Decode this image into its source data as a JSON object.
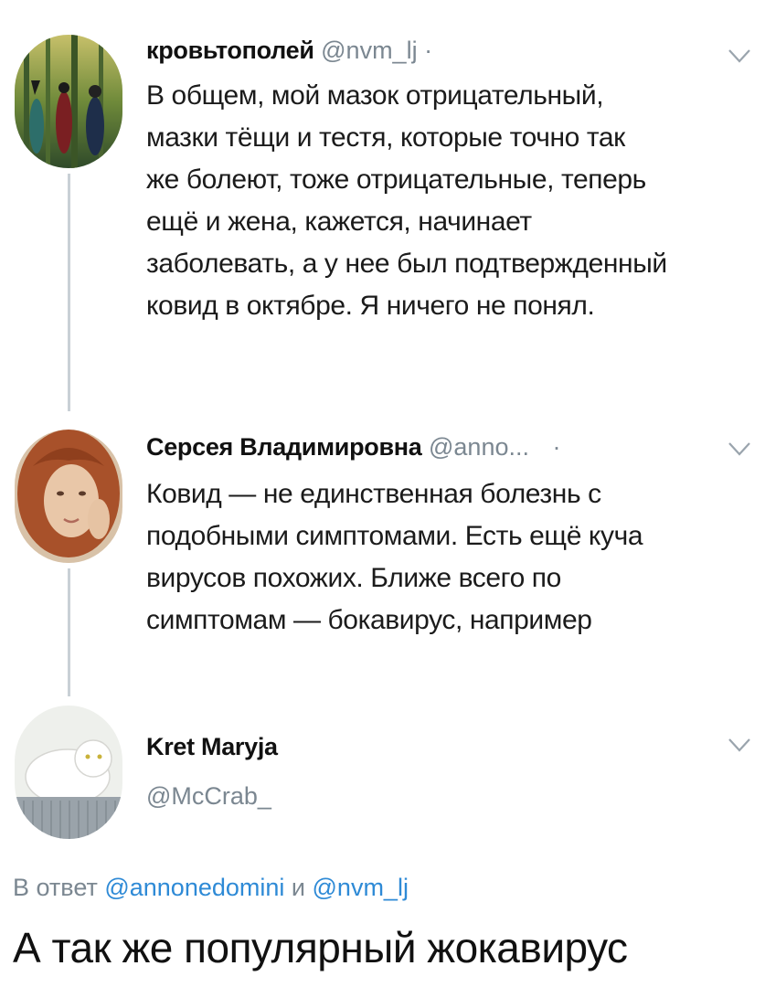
{
  "tweets": [
    {
      "name": "кровьтополей",
      "handle": "@nvm_lj",
      "separator": "·",
      "text_lines": [
        "В общем, мой мазок отрицательный,",
        "мазки тёщи и тестя, которые точно так",
        "же болеют, тоже отрицательные, теперь",
        "ещё и жена, кажется, начинает",
        "заболевать, а у нее был подтвержденный",
        "ковид в октябре. Я ничего не понял."
      ]
    },
    {
      "name": "Серсея Владимировна",
      "handle": "@anno...",
      "separator": "·",
      "text_lines": [
        "Ковид — не единственная болезнь с",
        "подобными симптомами. Есть ещё куча",
        "вирусов похожих. Ближе всего по",
        "симптомам — бокавирус, например"
      ]
    }
  ],
  "main_tweet": {
    "name": "Kret Maryja",
    "handle": "@McCrab_",
    "reply_prefix": "В ответ",
    "reply_mention_1": "@annonedomini",
    "reply_conj": "и",
    "reply_mention_2": "@nvm_lj",
    "text": "А так же популярный жокавирус"
  },
  "colors": {
    "secondary_text": "#7b8791",
    "mention": "#2e8ad6",
    "thread_line": "#c9d0d6"
  },
  "icons": [
    "chevron-down-icon"
  ]
}
